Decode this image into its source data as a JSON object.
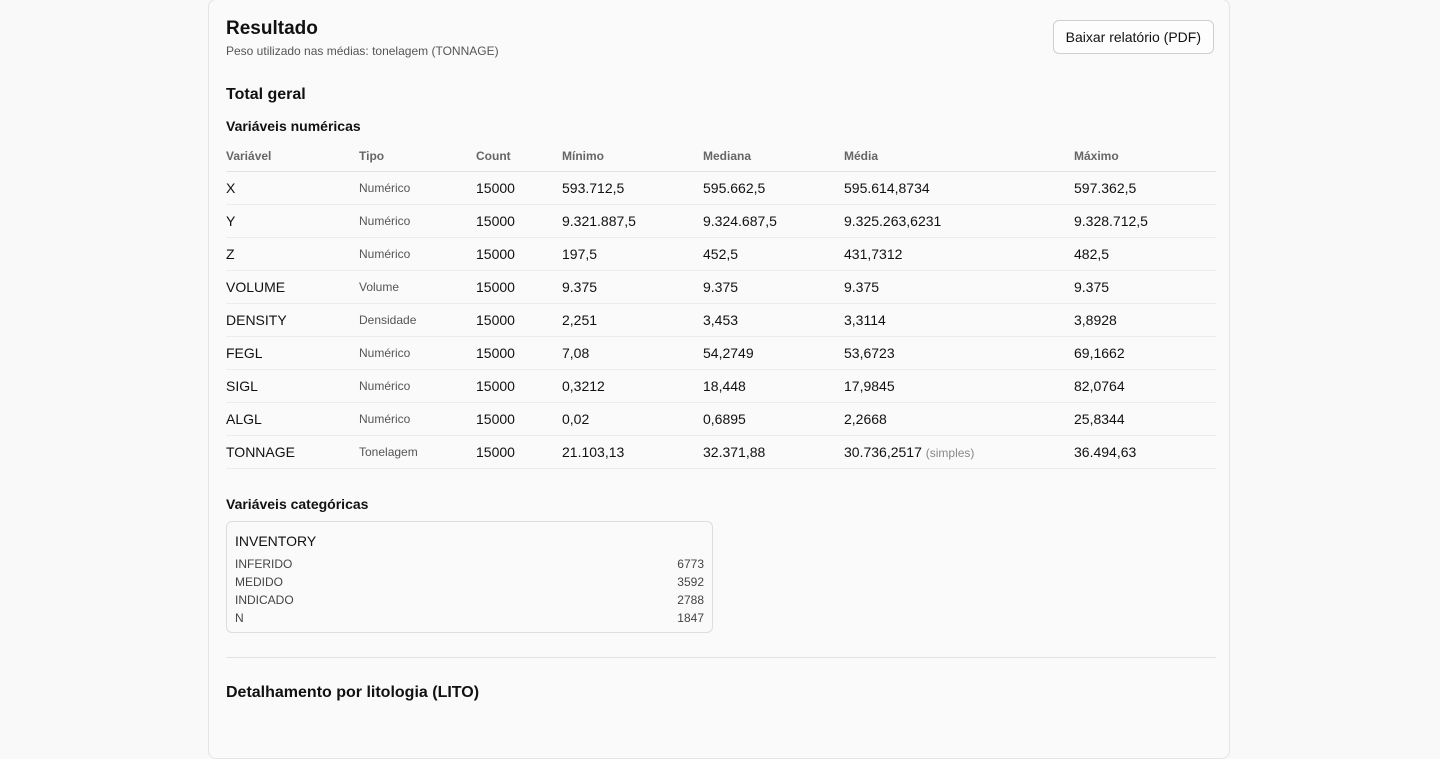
{
  "header": {
    "title": "Resultado",
    "subtitle": "Peso utilizado nas médias: tonelagem (TONNAGE)",
    "pdf_button": "Baixar relatório (PDF)"
  },
  "total": {
    "heading": "Total geral",
    "numeric_heading": "Variáveis numéricas",
    "columns": [
      "Variável",
      "Tipo",
      "Count",
      "Mínimo",
      "Mediana",
      "Média",
      "Máximo"
    ],
    "rows": [
      {
        "var": "X",
        "tipo": "Numérico",
        "count": "15000",
        "min": "593.712,5",
        "median": "595.662,5",
        "mean": "595.614,8734",
        "mean_note": "",
        "max": "597.362,5"
      },
      {
        "var": "Y",
        "tipo": "Numérico",
        "count": "15000",
        "min": "9.321.887,5",
        "median": "9.324.687,5",
        "mean": "9.325.263,6231",
        "mean_note": "",
        "max": "9.328.712,5"
      },
      {
        "var": "Z",
        "tipo": "Numérico",
        "count": "15000",
        "min": "197,5",
        "median": "452,5",
        "mean": "431,7312",
        "mean_note": "",
        "max": "482,5"
      },
      {
        "var": "VOLUME",
        "tipo": "Volume",
        "count": "15000",
        "min": "9.375",
        "median": "9.375",
        "mean": "9.375",
        "mean_note": "",
        "max": "9.375"
      },
      {
        "var": "DENSITY",
        "tipo": "Densidade",
        "count": "15000",
        "min": "2,251",
        "median": "3,453",
        "mean": "3,3114",
        "mean_note": "",
        "max": "3,8928"
      },
      {
        "var": "FEGL",
        "tipo": "Numérico",
        "count": "15000",
        "min": "7,08",
        "median": "54,2749",
        "mean": "53,6723",
        "mean_note": "",
        "max": "69,1662"
      },
      {
        "var": "SIGL",
        "tipo": "Numérico",
        "count": "15000",
        "min": "0,3212",
        "median": "18,448",
        "mean": "17,9845",
        "mean_note": "",
        "max": "82,0764"
      },
      {
        "var": "ALGL",
        "tipo": "Numérico",
        "count": "15000",
        "min": "0,02",
        "median": "0,6895",
        "mean": "2,2668",
        "mean_note": "",
        "max": "25,8344"
      },
      {
        "var": "TONNAGE",
        "tipo": "Tonelagem",
        "count": "15000",
        "min": "21.103,13",
        "median": "32.371,88",
        "mean": "30.736,2517",
        "mean_note": "(simples)",
        "max": "36.494,63"
      }
    ],
    "categorical_heading": "Variáveis categóricas",
    "categorical": {
      "name": "INVENTORY",
      "items": [
        {
          "label": "INFERIDO",
          "count": "6773"
        },
        {
          "label": "MEDIDO",
          "count": "3592"
        },
        {
          "label": "INDICADO",
          "count": "2788"
        },
        {
          "label": "N",
          "count": "1847"
        }
      ]
    }
  },
  "lito": {
    "heading": "Detalhamento por litologia (LITO)"
  }
}
